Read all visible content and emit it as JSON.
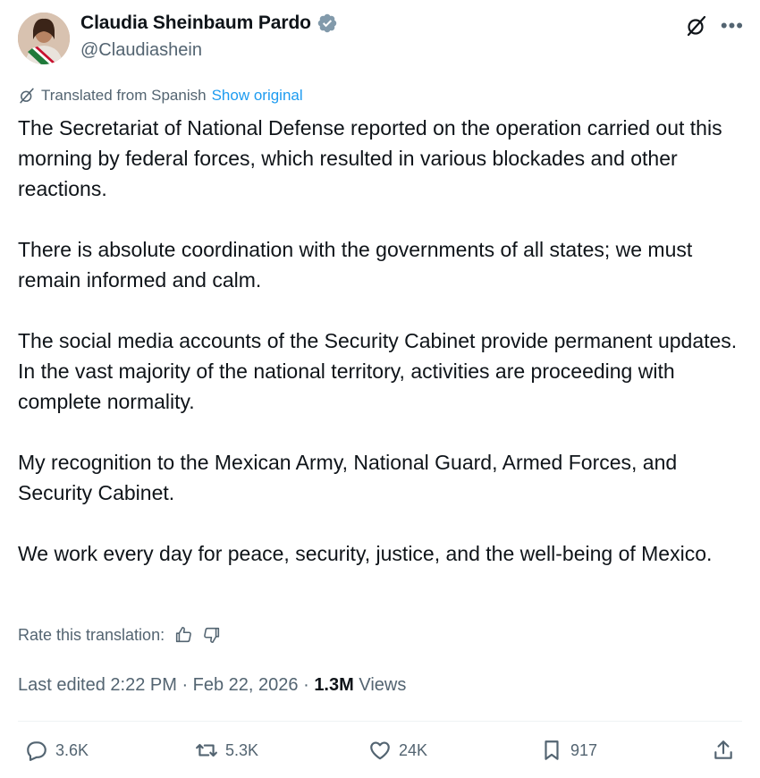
{
  "author": {
    "name": "Claudia Sheinbaum Pardo",
    "handle": "@Claudiashein"
  },
  "translation": {
    "label": "Translated from Spanish",
    "show_original": "Show original"
  },
  "body": {
    "paragraphs": [
      "The Secretariat of National Defense reported on the operation carried out this morning by federal forces, which resulted in various blockades and other reactions.",
      "There is absolute coordination with the governments of all states; we must remain informed and calm.",
      "The social media accounts of the Security Cabinet provide permanent updates. In the vast majority of the national territory, activities are proceeding with complete normality.",
      "My recognition to the Mexican Army, National Guard, Armed Forces, and Security Cabinet.",
      "We work every day for peace, security, justice, and the well-being of Mexico."
    ]
  },
  "rate": {
    "label": "Rate this translation:"
  },
  "meta": {
    "edited": "Last edited 2:22 PM · Feb 22, 2026 · ",
    "views_count": "1.3M",
    "views_label": " Views"
  },
  "actions": {
    "replies": "3.6K",
    "reposts": "5.3K",
    "likes": "24K",
    "bookmarks": "917"
  },
  "colors": {
    "text": "#0f1419",
    "secondary": "#536471",
    "link": "#1d9bf0",
    "verified": "#829aab"
  },
  "icons": [
    "verified-badge-icon",
    "grok-icon",
    "more-icon",
    "translate-icon",
    "thumbs-up-icon",
    "thumbs-down-icon",
    "reply-icon",
    "repost-icon",
    "like-icon",
    "bookmark-icon",
    "share-icon"
  ]
}
